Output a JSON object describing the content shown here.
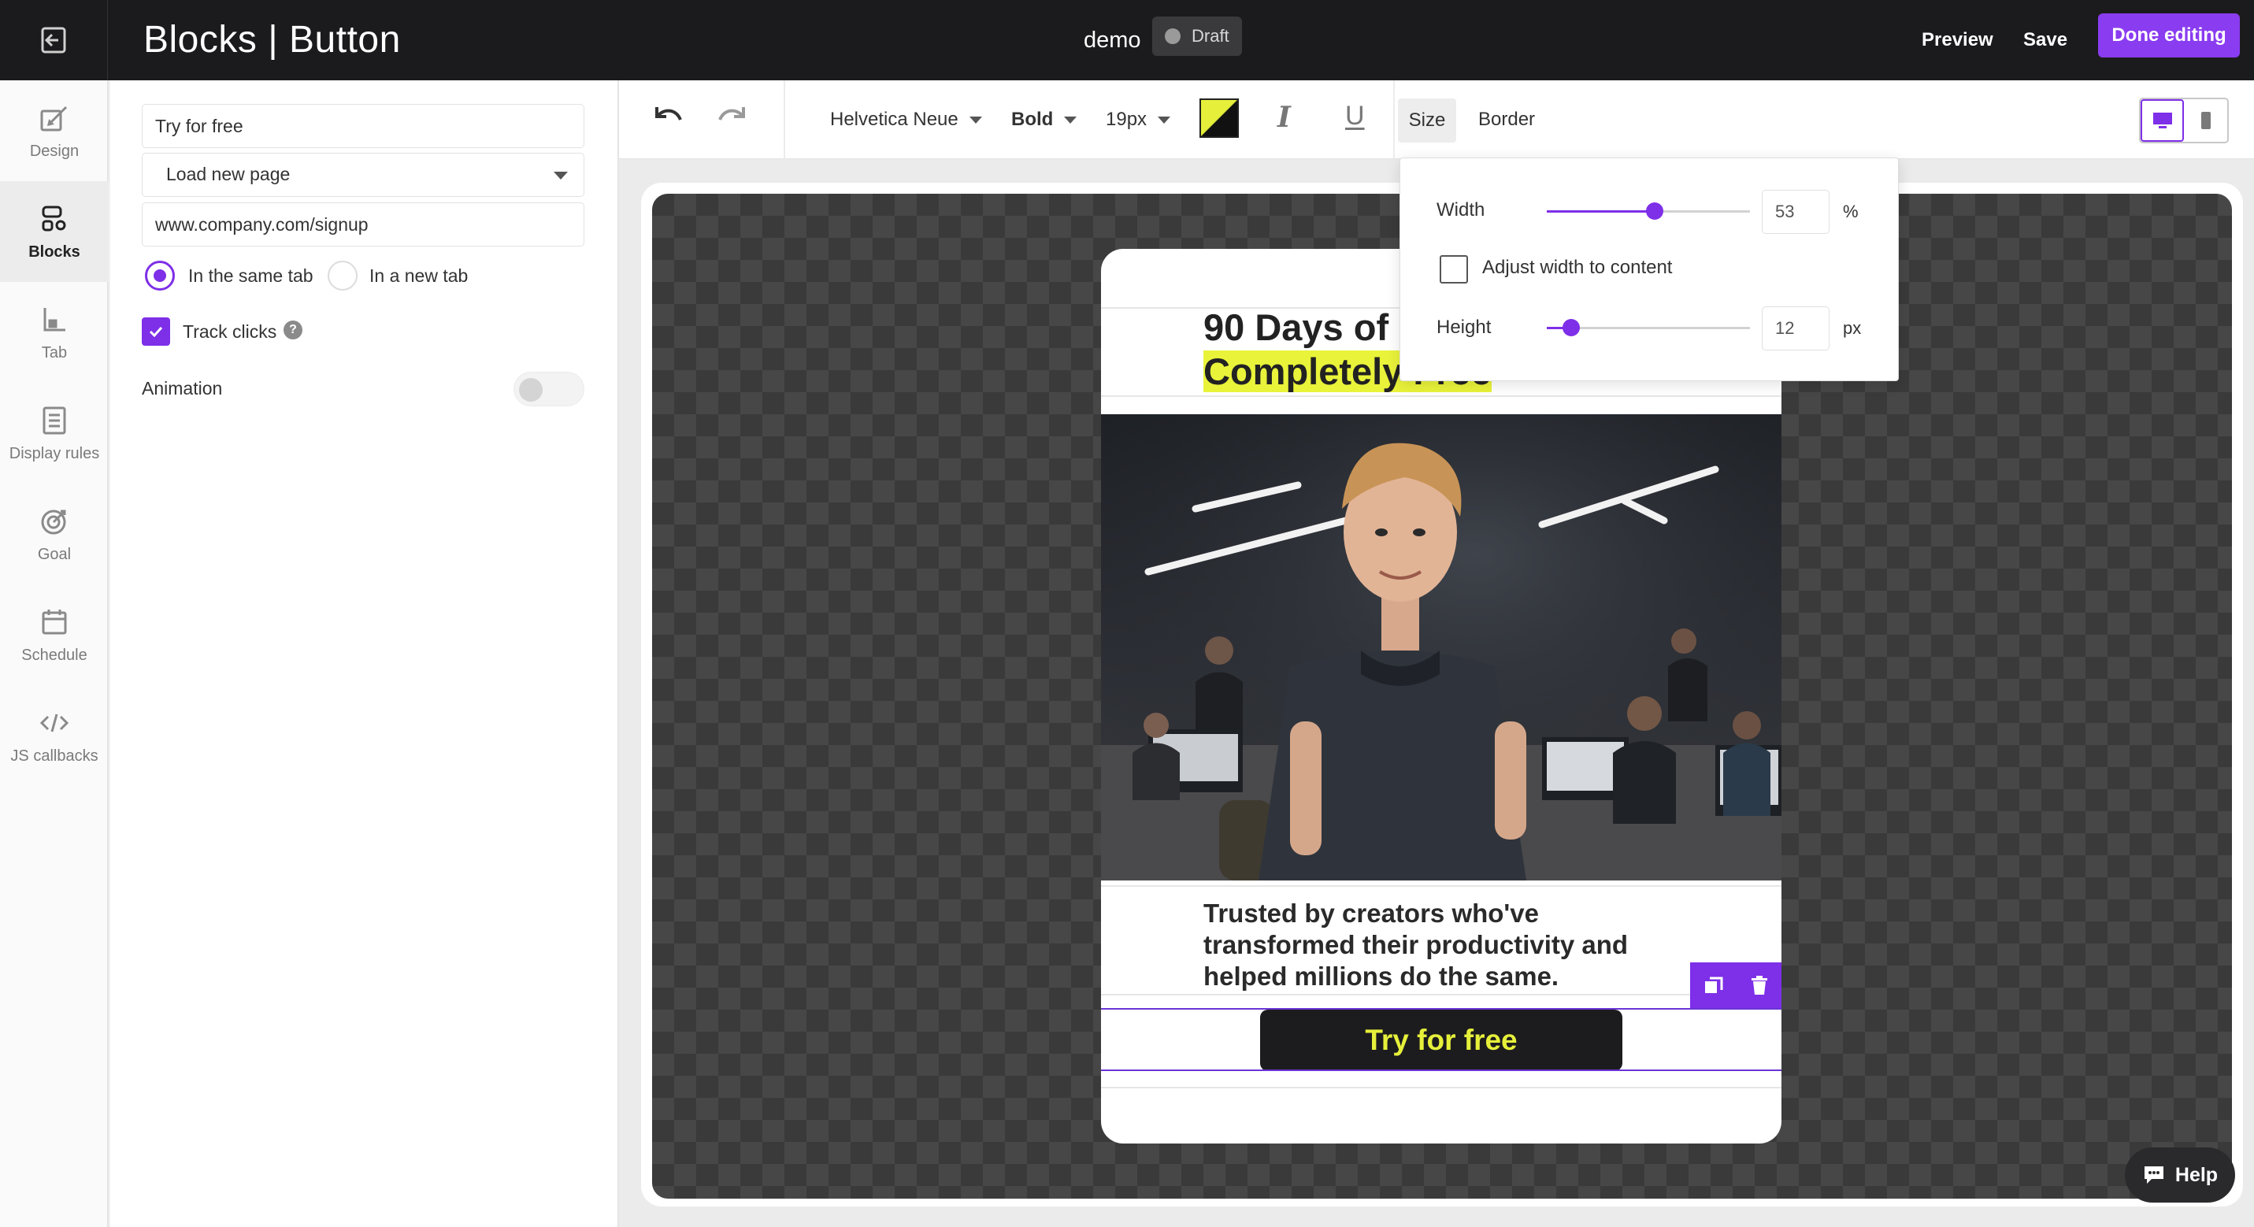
{
  "header": {
    "title": "Blocks | Button",
    "campaign_name": "demo",
    "status": "Draft",
    "preview_label": "Preview",
    "save_label": "Save",
    "done_label": "Done editing"
  },
  "nav": {
    "items": [
      {
        "label": "Design",
        "icon": "brush-icon"
      },
      {
        "label": "Blocks",
        "icon": "blocks-icon"
      },
      {
        "label": "Tab",
        "icon": "tab-icon"
      },
      {
        "label": "Display rules",
        "icon": "list-icon"
      },
      {
        "label": "Goal",
        "icon": "target-icon"
      },
      {
        "label": "Schedule",
        "icon": "calendar-icon"
      },
      {
        "label": "JS callbacks",
        "icon": "code-icon"
      }
    ],
    "active": "Blocks"
  },
  "settings": {
    "button_text": "Try for free",
    "action": "Load new page",
    "url": "www.company.com/signup",
    "target_same_tab": "In the same tab",
    "target_new_tab": "In a new tab",
    "target_selected": "same",
    "track_clicks_label": "Track clicks",
    "track_clicks": true,
    "help_glyph": "?",
    "animation_label": "Animation",
    "animation": false
  },
  "toolbar": {
    "font": "Helvetica Neue",
    "weight": "Bold",
    "size": "19px",
    "colors": {
      "text": "#e6f03a",
      "background": "#111111"
    },
    "italic_glyph": "I",
    "underline_glyph": "U",
    "size_tab": "Size",
    "border_tab": "Border",
    "device": "desktop"
  },
  "size_popover": {
    "width_label": "Width",
    "width_value": "53",
    "width_unit": "%",
    "width_fraction": 0.53,
    "adjust_label": "Adjust width to content",
    "adjust_checked": false,
    "height_label": "Height",
    "height_value": "12",
    "height_unit": "px",
    "height_fraction": 0.12
  },
  "popup": {
    "headline_line1": "90 Days of",
    "headline_line2": "Completely Free",
    "subtext": "Trusted by creators who've transformed their productivity and helped millions do the same.",
    "cta": "Try for free"
  },
  "help": {
    "label": "Help"
  },
  "theme": {
    "accent": "#7e2fe8",
    "topbar": "#1b1b1d",
    "highlight": "#e9f33a"
  }
}
